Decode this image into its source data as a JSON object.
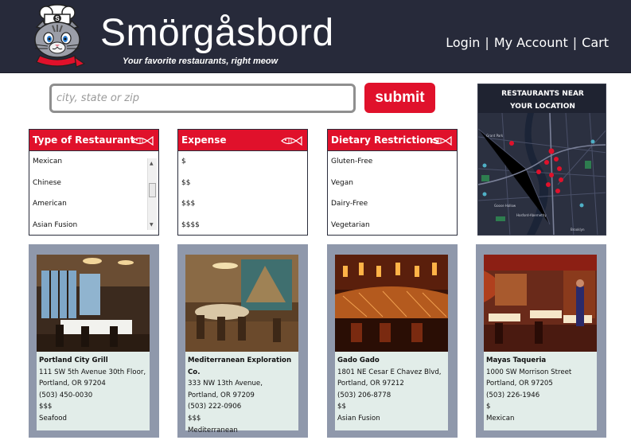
{
  "header": {
    "brand": "Smörgåsbord",
    "tagline": "Your favorite restaurants, right meow",
    "nav": {
      "login": "Login",
      "separator": "|",
      "account": "My Account",
      "cart": "Cart"
    }
  },
  "search": {
    "placeholder": "city, state or zip",
    "submit_label": "submit"
  },
  "filters": [
    {
      "title": "Type of Restaurant",
      "options": [
        "Mexican",
        "Chinese",
        "American",
        "Asian Fusion"
      ]
    },
    {
      "title": "Expense",
      "options": [
        "$",
        "$$",
        "$$$",
        "$$$$"
      ]
    },
    {
      "title": "Dietary Restrictions",
      "options": [
        "Gluten-Free",
        "Vegan",
        "Dairy-Free",
        "Vegetarian"
      ]
    }
  ],
  "map": {
    "title_line1": "RESTAURANTS NEAR",
    "title_line2": "YOUR LOCATION"
  },
  "restaurants": [
    {
      "name": "Portland City Grill",
      "address1": "111 SW 5th Avenue 30th Floor,",
      "address2": "Portland, OR 97204",
      "phone": "(503) 450-0030",
      "price": "$$$",
      "cuisine": "Seafood"
    },
    {
      "name": "Mediterranean Exploration Co.",
      "address1": "333 NW 13th Avenue,",
      "address2": "Portland, OR 97209",
      "phone": "(503) 222-0906",
      "price": "$$$",
      "cuisine": "Mediterranean"
    },
    {
      "name": "Gado Gado",
      "address1": "1801 NE Cesar E Chavez Blvd,",
      "address2": "Portland, OR 97212",
      "phone": "(503) 206-8778",
      "price": "$$",
      "cuisine": "Asian Fusion"
    },
    {
      "name": "Mayas Taqueria",
      "address1": "1000 SW Morrison Street",
      "address2": "Portland, OR 97205",
      "phone": "(503) 226-1946",
      "price": "$",
      "cuisine": "Mexican"
    }
  ],
  "colors": {
    "header_bg": "#272a3a",
    "accent_red": "#e0112b",
    "card_bg": "#8f98ab",
    "card_info_bg": "#e2ede9"
  }
}
